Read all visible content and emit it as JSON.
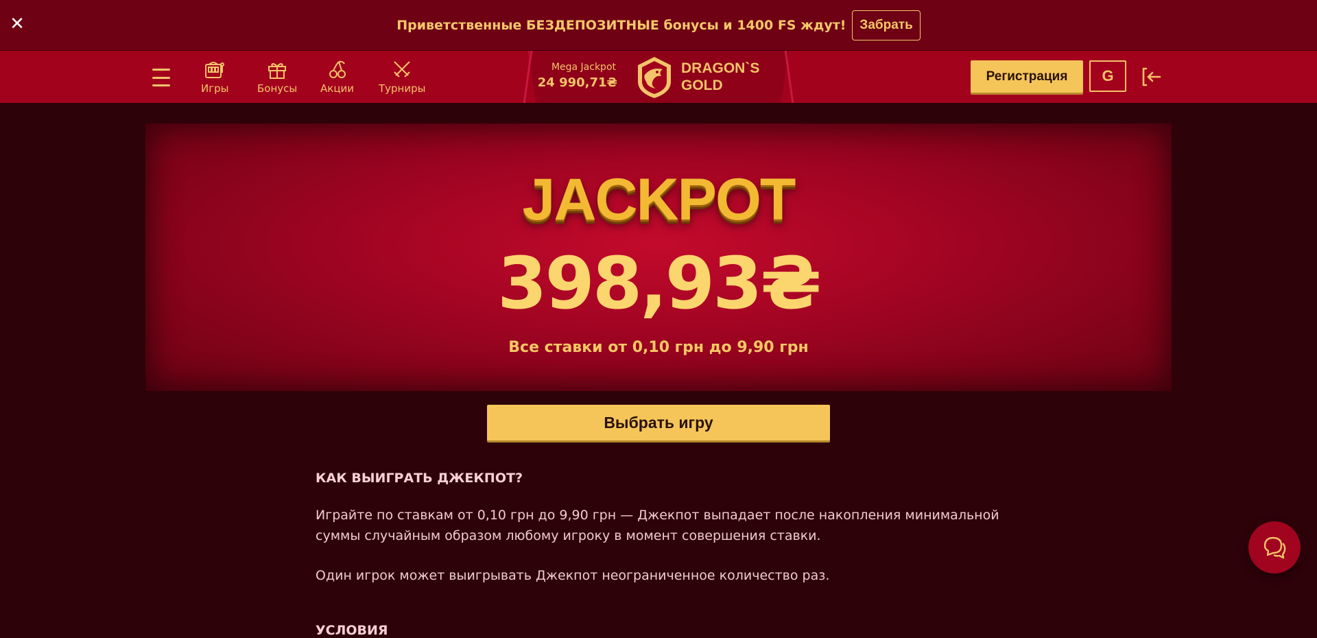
{
  "promo": {
    "text": "Приветственные БЕЗДЕПОЗИТНЫЕ бонусы и 1400 FS ждут!",
    "button": "Забрать",
    "close": "✕"
  },
  "header": {
    "nav": [
      {
        "label": "Игры",
        "icon": "slot-machine-icon"
      },
      {
        "label": "Бонусы",
        "icon": "gift-icon"
      },
      {
        "label": "Акции",
        "icon": "cherries-icon"
      },
      {
        "label": "Турниры",
        "icon": "crossed-swords-icon"
      }
    ],
    "mega_jackpot_label": "Mega Jackpot",
    "mega_jackpot_value": "24 990,71₴",
    "logo_line1": "DRAGON`S",
    "logo_line2": "GOLD",
    "register_label": "Регистрация",
    "google_label": "G"
  },
  "hero": {
    "title": "JACKPOT",
    "amount": "398,93₴",
    "subtitle": "Все ставки от 0,10 грн до 9,90 грн"
  },
  "choose_game_label": "Выбрать игру",
  "content": {
    "heading": "КАК ВЫИГРАТЬ ДЖЕКПОТ?",
    "paragraph1": "Играйте по ставкам от 0,10 грн до 9,90 грн — Джекпот выпадает после накопления минимальной суммы случайным образом любому игроку в момент совершения ставки.",
    "paragraph2": "Один игрок может выигрывать Джекпот неограниченное количество раз.",
    "conditions_heading": "УСЛОВИЯ"
  },
  "colors": {
    "background": "#2e0209",
    "header": "#a3021d",
    "promo_bar": "#6e0114",
    "accent_gold": "#f5c55a"
  }
}
